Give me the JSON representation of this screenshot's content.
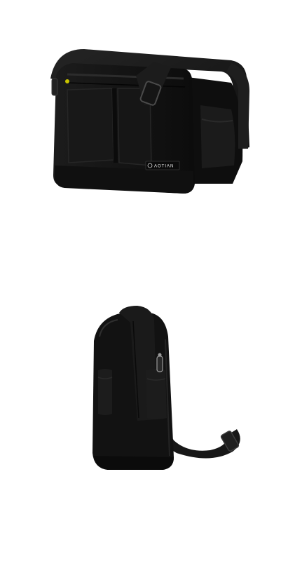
{
  "product": {
    "logo_text": "AOTIAN"
  },
  "images": [
    {
      "name": "front-angle-view",
      "icon": "messenger-bag-front"
    },
    {
      "name": "side-view",
      "icon": "messenger-bag-side"
    }
  ],
  "colors": {
    "background": "#ffffff",
    "bag_body": "#141414",
    "strap": "#1a1a1a",
    "highlight": "#2e2e2e",
    "zipper": "#9a9a9a"
  }
}
